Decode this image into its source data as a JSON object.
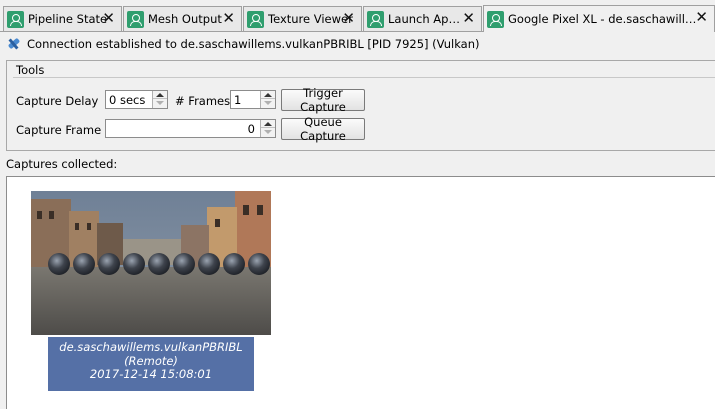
{
  "tabs": [
    {
      "label": "Pipeline State",
      "icon": "user-icon",
      "active": false
    },
    {
      "label": "Mesh Output",
      "icon": "user-icon",
      "active": false
    },
    {
      "label": "Texture Viewer",
      "icon": "user-icon",
      "active": false
    },
    {
      "label": "Launch Applic...",
      "icon": "user-icon",
      "active": false
    },
    {
      "label": "Google Pixel XL - de.saschawillems.vul...",
      "icon": "user-icon",
      "active": true
    }
  ],
  "tab_close_glyph": "✕",
  "connection": {
    "icon": "connect-icon",
    "text": "Connection established to de.saschawillems.vulkanPBRIBL [PID 7925] (Vulkan)"
  },
  "tools": {
    "title": "Tools",
    "capture_delay_label": "Capture Delay",
    "capture_delay_value": "0 secs",
    "frames_label": "# Frames:",
    "frames_value": "1",
    "trigger_button": "Trigger Capture",
    "capture_frame_label": "Capture Frame #",
    "capture_frame_value": "0",
    "queue_button": "Queue Capture"
  },
  "captures": {
    "label": "Captures collected:",
    "items": [
      {
        "name": "de.saschawillems.vulkanPBRIBL (Remote)",
        "timestamp": "2017-12-14 15:08:01"
      }
    ]
  },
  "colors": {
    "tab_icon": "#2f9e6e",
    "caption_bg": "#5570a6",
    "connect_icon": "#4a8ad0"
  }
}
